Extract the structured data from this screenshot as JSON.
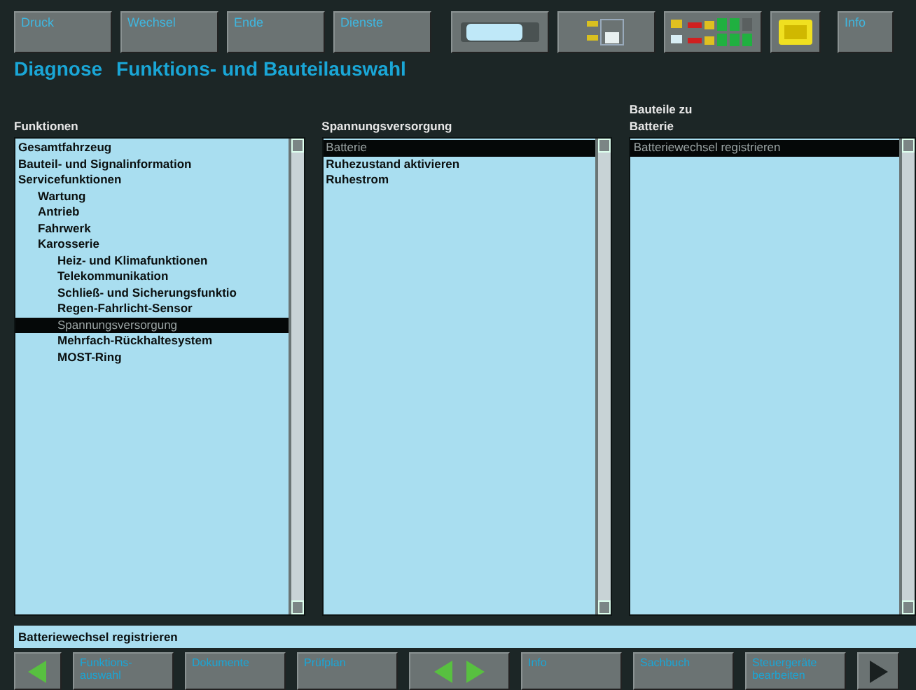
{
  "toolbar": {
    "buttons": [
      {
        "label": "Druck"
      },
      {
        "label": "Wechsel"
      },
      {
        "label": "Ende"
      },
      {
        "label": "Dienste"
      }
    ],
    "info_button": "Info"
  },
  "title": {
    "section": "Diagnose",
    "page": "Funktions- und Bauteilauswahl"
  },
  "columns": [
    {
      "heading": [
        "Funktionen"
      ],
      "items": [
        {
          "label": "Gesamtfahrzeug",
          "selected": false
        },
        {
          "label": "Bauteil- und Signalinformation",
          "selected": false
        },
        {
          "label": "Servicefunktionen",
          "selected": false,
          "children": [
            {
              "label": "Wartung",
              "selected": false
            },
            {
              "label": "Antrieb",
              "selected": false
            },
            {
              "label": "Fahrwerk",
              "selected": false
            },
            {
              "label": "Karosserie",
              "selected": false,
              "children": [
                {
                  "label": "Heiz- und Klimafunktionen",
                  "selected": false
                },
                {
                  "label": "Telekommunikation",
                  "selected": false
                },
                {
                  "label": "Schließ- und Sicherungsfunktio",
                  "selected": false
                },
                {
                  "label": "Regen-Fahrlicht-Sensor",
                  "selected": false
                },
                {
                  "label": "Spannungsversorgung",
                  "selected": true
                },
                {
                  "label": "Mehrfach-Rückhaltesystem",
                  "selected": false
                },
                {
                  "label": "MOST-Ring",
                  "selected": false
                }
              ]
            }
          ]
        }
      ]
    },
    {
      "heading": [
        "Spannungsversorgung"
      ],
      "items": [
        {
          "label": "Batterie",
          "selected": true
        },
        {
          "label": "Ruhezustand aktivieren",
          "selected": false
        },
        {
          "label": "Ruhestrom",
          "selected": false
        }
      ]
    },
    {
      "heading": [
        "Bauteile zu",
        "Batterie"
      ],
      "items": [
        {
          "label": "Batteriewechsel registrieren",
          "selected": true
        }
      ]
    }
  ],
  "status_line": "Batteriewechsel registrieren",
  "bottom_bar": [
    {
      "kind": "back"
    },
    {
      "kind": "button",
      "label": "Funktions- auswahl"
    },
    {
      "kind": "button",
      "label": "Dokumente"
    },
    {
      "kind": "button",
      "label": "Prüfplan"
    },
    {
      "kind": "pair"
    },
    {
      "kind": "button",
      "label": "Info"
    },
    {
      "kind": "button",
      "label": "Sachbuch"
    },
    {
      "kind": "button",
      "label": "Steuergeräte bearbeiten"
    },
    {
      "kind": "forward"
    }
  ]
}
